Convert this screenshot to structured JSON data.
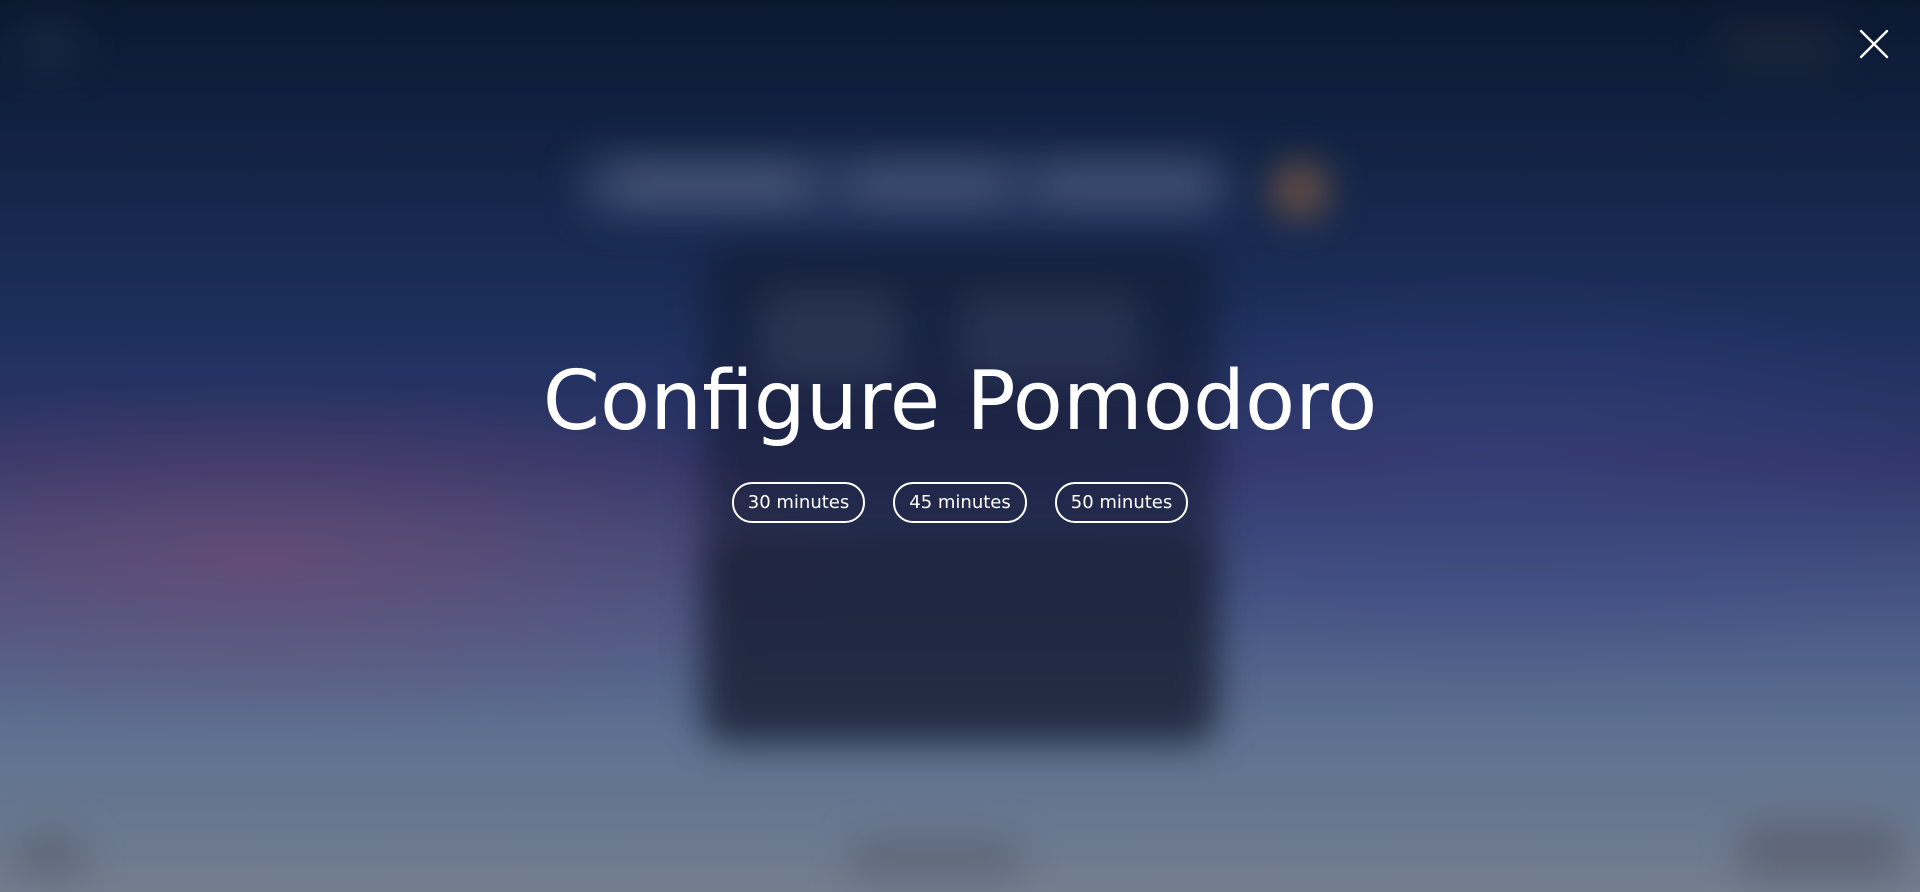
{
  "modal": {
    "title": "Configure Pomodoro",
    "options": [
      {
        "label": "30 minutes"
      },
      {
        "label": "45 minutes"
      },
      {
        "label": "50 minutes"
      }
    ],
    "close_icon": "close-icon"
  },
  "colors": {
    "text": "#ffffff",
    "outline": "#ffffff"
  }
}
